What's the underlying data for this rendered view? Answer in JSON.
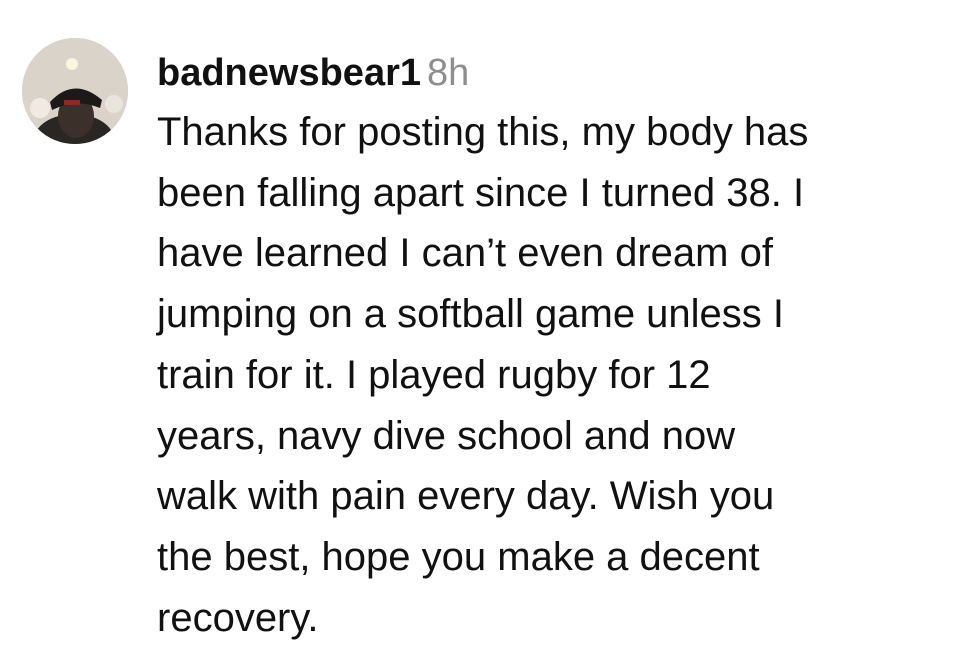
{
  "comment": {
    "username": "badnewsbear1",
    "time": "8h",
    "avatar_icon": "user-avatar-photo",
    "lines": [
      "Thanks for posting this, my body has",
      "been falling apart since I turned 38. I",
      "have learned I can’t even dream of",
      "jumping on a softball game unless I",
      "train for it. I played rugby for 12",
      "years, navy dive school and now",
      "walk with pain every day. Wish you",
      "the best, hope you make a decent",
      "recovery."
    ]
  },
  "colors": {
    "username": "#111111",
    "timestamp": "#8e8e8e",
    "text": "#111111",
    "background": "#ffffff"
  }
}
